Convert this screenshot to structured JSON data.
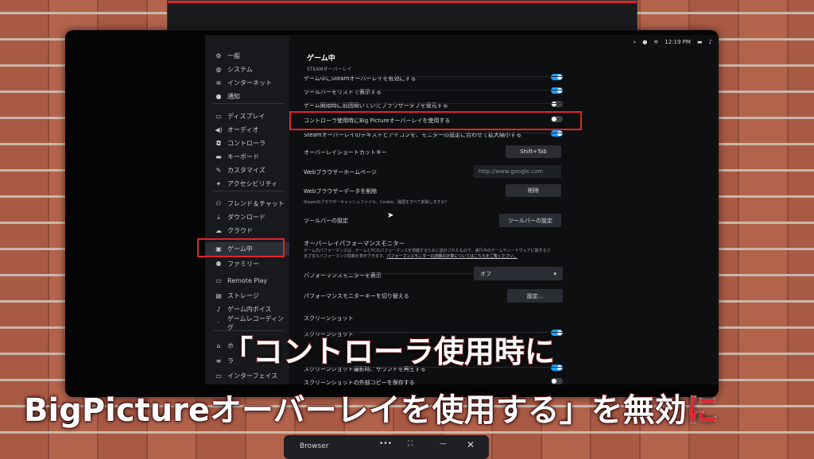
{
  "status": {
    "time": "12:19 PM"
  },
  "sidebar": {
    "items": [
      {
        "label": "一般",
        "icon": "gear-icon",
        "glyph": "⚙"
      },
      {
        "label": "システム",
        "icon": "system-icon",
        "glyph": "◍"
      },
      {
        "label": "インターネット",
        "icon": "wifi-icon",
        "glyph": "≋"
      },
      {
        "label": "通知",
        "icon": "notification-icon",
        "glyph": "●"
      },
      {
        "label": "ディスプレイ",
        "icon": "display-icon",
        "glyph": "▭"
      },
      {
        "label": "オーディオ",
        "icon": "audio-icon",
        "glyph": "◀)"
      },
      {
        "label": "コントローラ",
        "icon": "controller-icon",
        "glyph": "◘"
      },
      {
        "label": "キーボード",
        "icon": "keyboard-icon",
        "glyph": "▬"
      },
      {
        "label": "カスタマイズ",
        "icon": "customize-icon",
        "glyph": "✎"
      },
      {
        "label": "アクセシビリティ",
        "icon": "accessibility-icon",
        "glyph": "✦"
      },
      {
        "label": "フレンド＆チャット",
        "icon": "friends-icon",
        "glyph": "⚇"
      },
      {
        "label": "ダウンロード",
        "icon": "download-icon",
        "glyph": "⤓"
      },
      {
        "label": "クラウド",
        "icon": "cloud-icon",
        "glyph": "☁"
      },
      {
        "label": "ゲーム中",
        "icon": "in-game-icon",
        "glyph": "▣"
      },
      {
        "label": "ファミリー",
        "icon": "family-icon",
        "glyph": "⚉"
      },
      {
        "label": "Remote Play",
        "icon": "remote-play-icon",
        "glyph": "▭"
      },
      {
        "label": "ストレージ",
        "icon": "storage-icon",
        "glyph": "▤"
      },
      {
        "label": "ゲーム内ボイス",
        "icon": "microphone-icon",
        "glyph": "♪"
      },
      {
        "label": "ゲームレコーディング",
        "icon": "recording-icon",
        "glyph": "·"
      },
      {
        "label": "ホ",
        "icon": "home-icon",
        "glyph": "⌂"
      },
      {
        "label": "ラ",
        "icon": "library-icon",
        "glyph": "≡"
      },
      {
        "label": "インターフェイス",
        "icon": "interface-icon",
        "glyph": "▭"
      }
    ]
  },
  "main": {
    "title": "ゲーム中",
    "overlay_section": "STEAMオーバーレイ",
    "toggles": [
      {
        "label": "ゲーム中にSteamオーバーレイを有効にする",
        "on": true
      },
      {
        "label": "ツールバーをリストで表示する",
        "on": true
      },
      {
        "label": "ゲーム開始時に前回開いていたブラウザータブを復元する",
        "on": false
      },
      {
        "label": "コントローラ使用時にBig Pictureオーバーレイを使用する",
        "on": false
      },
      {
        "label": "Steamオーバーレイのテキストとアイコンを、モニターの設定に合わせて拡大縮小する",
        "on": true
      }
    ],
    "shortcut_label": "オーバーレイショートカットキー",
    "shortcut_value": "Shift+Tab",
    "homepage_label": "Webブラウザーホームページ",
    "homepage_placeholder": "http://www.google.com",
    "delete_label": "Webブラウザーデータを削除",
    "delete_button": "削除",
    "delete_note": "Steamのブラウザーキャッシュファイル、Cookie、履歴をすべて削除しますか？",
    "toolbar_label": "ツールバーの設定",
    "toolbar_button": "ツールバーの設定",
    "perf_section": "オーバーレイパフォーマンスモニター",
    "perf_note_1": "ゲーム内パフォーマンスは、ゲームとPCのパフォーマンスを把握するために設計されたもので、実行中のゲームやハードウェアに関するさ",
    "perf_note_2": "まざまなパフォーマンス情報を表示できます。",
    "perf_note_link": "パフォーマンスモニターの詳細の計算についてはこちらをご覧ください。",
    "perf_show_label": "パフォーマンスモニターを表示",
    "perf_show_value": "オフ",
    "perf_key_label": "パフォーマンスモニターキーを切り替える",
    "perf_key_button": "設定...",
    "screenshot_section": "スクリーンショット",
    "screenshot_rows": [
      {
        "label": "スクリーンショット",
        "on": true
      },
      {
        "label": "スクリーンショット撮影時、サウンドを再生する",
        "on": true
      },
      {
        "label": "スクリーンショットの外部コピーを保存する",
        "on": false
      }
    ]
  },
  "caption": {
    "line1": "「コントローラ使用時に",
    "line2a": "BigPictureオーバーレイを使用する」を無効",
    "line2b": "に"
  },
  "browser": {
    "label": "Browser"
  }
}
